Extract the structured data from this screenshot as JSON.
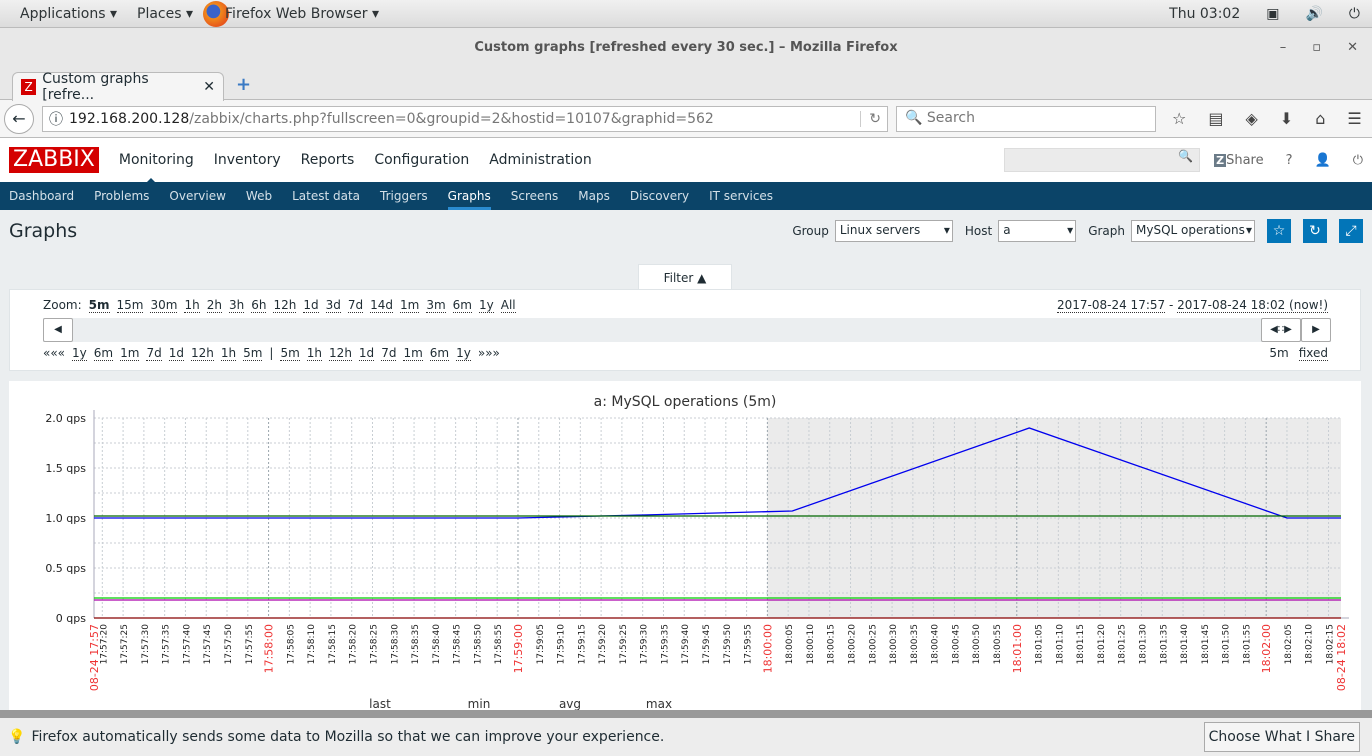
{
  "gnome": {
    "applications": "Applications",
    "places": "Places",
    "browser": "Firefox Web Browser",
    "clock": "Thu 03:02"
  },
  "window": {
    "title": "Custom graphs [refreshed every 30 sec.] – Mozilla Firefox"
  },
  "tab": {
    "label": "Custom graphs [refre...",
    "favicon": "Z"
  },
  "address": {
    "host": "192.168.200.128",
    "path": "/zabbix/charts.php?fullscreen=0&groupid=2&hostid=10107&graphid=562",
    "search_placeholder": "Search"
  },
  "zabbix": {
    "logo": "ZABBIX",
    "menu": [
      "Monitoring",
      "Inventory",
      "Reports",
      "Configuration",
      "Administration"
    ],
    "share": "Share",
    "submenu": [
      "Dashboard",
      "Problems",
      "Overview",
      "Web",
      "Latest data",
      "Triggers",
      "Graphs",
      "Screens",
      "Maps",
      "Discovery",
      "IT services"
    ],
    "active_sub": "Graphs"
  },
  "page": {
    "title": "Graphs",
    "group_label": "Group",
    "group": "Linux servers",
    "host_label": "Host",
    "host": "a",
    "graph_label": "Graph",
    "graph": "MySQL operations"
  },
  "filter": {
    "tab": "Filter ▲",
    "zoom_label": "Zoom:",
    "zoom": [
      "5m",
      "15m",
      "30m",
      "1h",
      "2h",
      "3h",
      "6h",
      "12h",
      "1d",
      "3d",
      "7d",
      "14d",
      "1m",
      "3m",
      "6m",
      "1y",
      "All"
    ],
    "zoom_active": "5m",
    "from": "2017-08-24 17:57",
    "sep": " - ",
    "to": "2017-08-24 18:02 (now!)",
    "back_label": "«««",
    "back": [
      "1y",
      "6m",
      "1m",
      "7d",
      "1d",
      "12h",
      "1h",
      "5m"
    ],
    "divider": "|",
    "fwd": [
      "5m",
      "1h",
      "12h",
      "1d",
      "7d",
      "1m",
      "6m",
      "1y"
    ],
    "fwd_label": "»»»",
    "period": "5m",
    "fixed": "fixed"
  },
  "chart_data": {
    "type": "line",
    "title": "a: MySQL operations (5m)",
    "ylim": [
      0,
      2
    ],
    "yticks": [
      "0 qps",
      "0.5 qps",
      "1.0 qps",
      "1.5 qps",
      "2.0 qps"
    ],
    "x_start_label": "08-24 17:57",
    "x_end_label": "08-24 18:02",
    "x_range": [
      "17:57:18",
      "18:02:18"
    ],
    "shaded_from": "18:00:00",
    "grid": true,
    "series": [
      {
        "color": "#0000ee",
        "points": [
          [
            "17:57:18",
            1.0
          ],
          [
            "17:59:00",
            1.0
          ],
          [
            "17:59:30",
            1.03
          ],
          [
            "18:00:06",
            1.07
          ],
          [
            "18:01:03",
            1.9
          ],
          [
            "18:02:05",
            1.0
          ],
          [
            "18:02:18",
            1.0
          ]
        ]
      },
      {
        "color": "#006600",
        "points": [
          [
            "17:57:18",
            1.02
          ],
          [
            "18:02:18",
            1.02
          ]
        ]
      },
      {
        "color": "#00cc00",
        "points": [
          [
            "17:57:18",
            0.2
          ],
          [
            "18:02:18",
            0.2
          ]
        ]
      },
      {
        "color": "#aa00aa",
        "points": [
          [
            "17:57:18",
            0.18
          ],
          [
            "18:02:18",
            0.18
          ]
        ]
      },
      {
        "color": "#880000",
        "points": [
          [
            "17:57:18",
            0.0
          ],
          [
            "18:02:18",
            0.0
          ]
        ]
      }
    ],
    "legend_headers": [
      "last",
      "min",
      "avg",
      "max"
    ]
  },
  "notification": {
    "text": "Firefox automatically sends some data to Mozilla so that we can improve your experience.",
    "button": "Choose What I Share"
  }
}
